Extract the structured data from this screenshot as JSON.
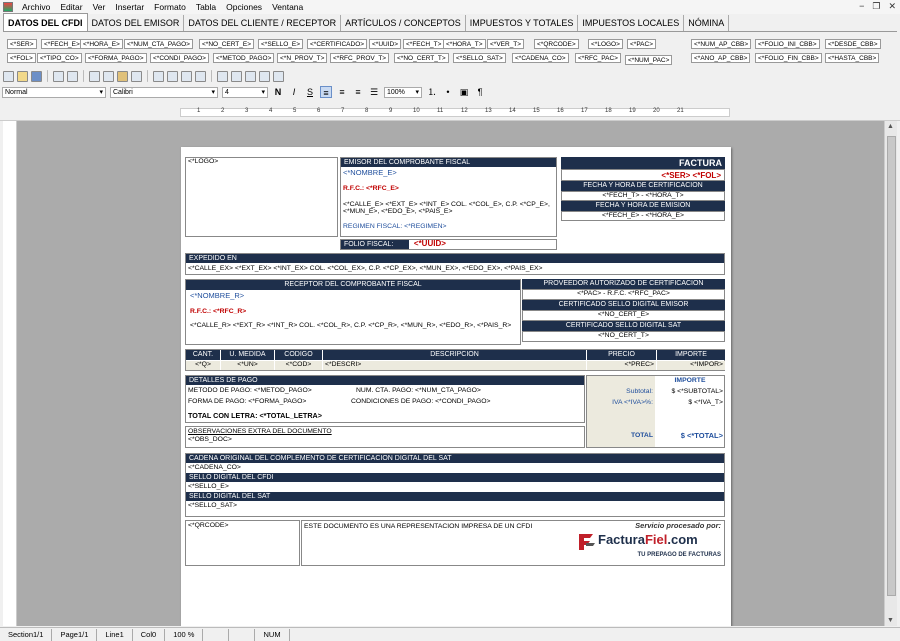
{
  "menu": {
    "items": [
      "Archivo",
      "Editar",
      "Ver",
      "Insertar",
      "Formato",
      "Tabla",
      "Opciones",
      "Ventana"
    ]
  },
  "tabs": [
    "DATOS DEL CFDI",
    "DATOS DEL EMISOR",
    "DATOS DEL CLIENTE / RECEPTOR",
    "ARTÍCULOS / CONCEPTOS",
    "IMPUESTOS Y TOTALES",
    "IMPUESTOS LOCALES",
    "NÓMINA"
  ],
  "tokens": {
    "row1": [
      "<*SER>",
      "<*FECH_E>",
      "<*HORA_E>",
      "<*NUM_CTA_PAGO>",
      "<*NO_CERT_E>",
      "<*SELLO_E>",
      "<*CERTIFICADO>",
      "<*UUID>",
      "<*FECH_T>",
      "<*HORA_T>",
      "<*VER_T>",
      "<*QRCODE>",
      "<*LOGO>",
      "<*PAC>",
      "<*NUM_AP_CBB>",
      "<*FOLIO_INI_CBB>",
      "<*DESDE_CBB>"
    ],
    "row2": [
      "<*FOL>",
      "<*TIPO_CO>",
      "<*FORMA_PAGO>",
      "<*CONDI_PAGO>",
      "<*METOD_PAGO>",
      "<*N_PROV_T>",
      "<*RFC_PROV_T>",
      "<*NO_CERT_T>",
      "<*SELLO_SAT>",
      "<*CADENA_CO>",
      "<*RFC_PAC>",
      "<*NUM_PAC>",
      "<*ANO_AP_CBB>",
      "<*FOLIO_FIN_CBB>",
      "<*HASTA_CBB>"
    ]
  },
  "format": {
    "style": "Normal",
    "font": "Calibri",
    "size": "4",
    "zoom": "100%"
  },
  "ruler": [
    "1",
    "2",
    "3",
    "4",
    "5",
    "6",
    "7",
    "8",
    "9",
    "10",
    "11",
    "12",
    "13",
    "14",
    "15",
    "16",
    "17",
    "18",
    "19",
    "20",
    "21"
  ],
  "status": [
    "Section1/1",
    "Page1/1",
    "Line1",
    "Col0",
    "100 %",
    "",
    "",
    "NUM"
  ],
  "doc": {
    "logo": "<*LOGO>",
    "emisor_title": "EMISOR DEL COMPROBANTE FISCAL",
    "nombre_e": "<*NOMBRE_E>",
    "rfc_e": "R.F.C.: <*RFC_E>",
    "addr_e": "<*CALLE_E> <*EXT_E> <*INT_E> COL. <*COL_E>, C.P. <*CP_E>, <*MUN_E>, <*EDO_E>, <*PAIS_E>",
    "regimen": "REGIMEN FISCAL: <*REGIMEN>",
    "folio_fiscal": "FOLIO FISCAL:",
    "uuid": "<*UUID>",
    "factura": "FACTURA",
    "ser_fol": "<*SER> <*FOL>",
    "fecha_cert": "FECHA Y HORA DE CERTIFICACION",
    "fech_t": "<*FECH_T> - <*HORA_T>",
    "fecha_emision": "FECHA Y HORA DE EMISION",
    "fech_e": "<*FECH_E> - <*HORA_E>",
    "expedido": "EXPEDIDO EN",
    "addr_ex": "<*CALLE_EX> <*EXT_EX>   <*INT_EX>  COL. <*COL_EX>, C.P. <*CP_EX>, <*MUN_EX>, <*EDO_EX>, <*PAIS_EX>",
    "receptor_title": "RECEPTOR DEL COMPROBANTE FISCAL",
    "nombre_r": "<*NOMBRE_R>",
    "rfc_r": "R.F.C.: <*RFC_R>",
    "addr_r": "<*CALLE_R> <*EXT_R> <*INT_R> COL. <*COL_R>,  C.P. <*CP_R>, <*MUN_R>, <*EDO_R>, <*PAIS_R>",
    "pac_title": "PROVEEDOR AUTORIZADO DE CERTIFICACION",
    "pac": "<*PAC> - R.F.C. <*RFC_PAC>",
    "cert_emisor": "CERTIFICADO SELLO DIGITAL EMISOR",
    "no_cert_e": "<*NO_CERT_E>",
    "cert_sat": "CERTIFICADO SELLO DIGITAL SAT",
    "no_cert_t": "<*NO_CERT_T>",
    "cols": [
      "CANT.",
      "U. MEDIDA",
      "CODIGO",
      "DESCRIPCION",
      "PRECIO",
      "IMPORTE"
    ],
    "row": [
      "<*Q>",
      "<*UN>",
      "<*COD>",
      "<*DESCRI>",
      "<*PREC>",
      "<*IMPOR>"
    ],
    "detalles": "DETALLES DE PAGO",
    "metodo": "METODO DE PAGO: <*METOD_PAGO>",
    "num_cta": "NUM. CTA. PAGO: <*NUM_CTA_PAGO>",
    "forma": "FORMA DE PAGO: <*FORMA_PAGO>",
    "condi": "CONDICIONES DE PAGO: <*CONDI_PAGO>",
    "total_letra": "TOTAL CON LETRA: <*TOTAL_LETRA>",
    "obs_title": "OBSERVACIONES EXTRA DEL DOCUMENTO",
    "obs": "<*OBS_DOC>",
    "importe": "IMPORTE",
    "subtotal_l": "Subtotal:",
    "subtotal_v": "$ <*SUBTOTAL>",
    "iva_l": "IVA <*IVA>%:",
    "iva_v": "$ <*IVA_T>",
    "total_l": "TOTAL",
    "total_v": "$ <*TOTAL>",
    "cadena_title": "CADENA ORIGINAL DEL COMPLEMENTO DE CERTIFICACION DIGITAL DEL SAT",
    "cadena": "<*CADENA_CO>",
    "sello_cfdi_title": "SELLO DIGITAL DEL CFDI",
    "sello_e": "<*SELLO_E>",
    "sello_sat_title": "SELLO DIGITAL DEL SAT",
    "sello_sat": "<*SELLO_SAT>",
    "qr": "<*QRCODE>",
    "leyenda": "ESTE DOCUMENTO ES UNA REPRESENTACION IMPRESA DE UN CFDI",
    "servicio": "Servicio procesado por:",
    "brand_a": "Factura",
    "brand_b": "Fiel",
    "brand_c": ".com",
    "slogan": "TU PREPAGO DE FACTURAS"
  }
}
